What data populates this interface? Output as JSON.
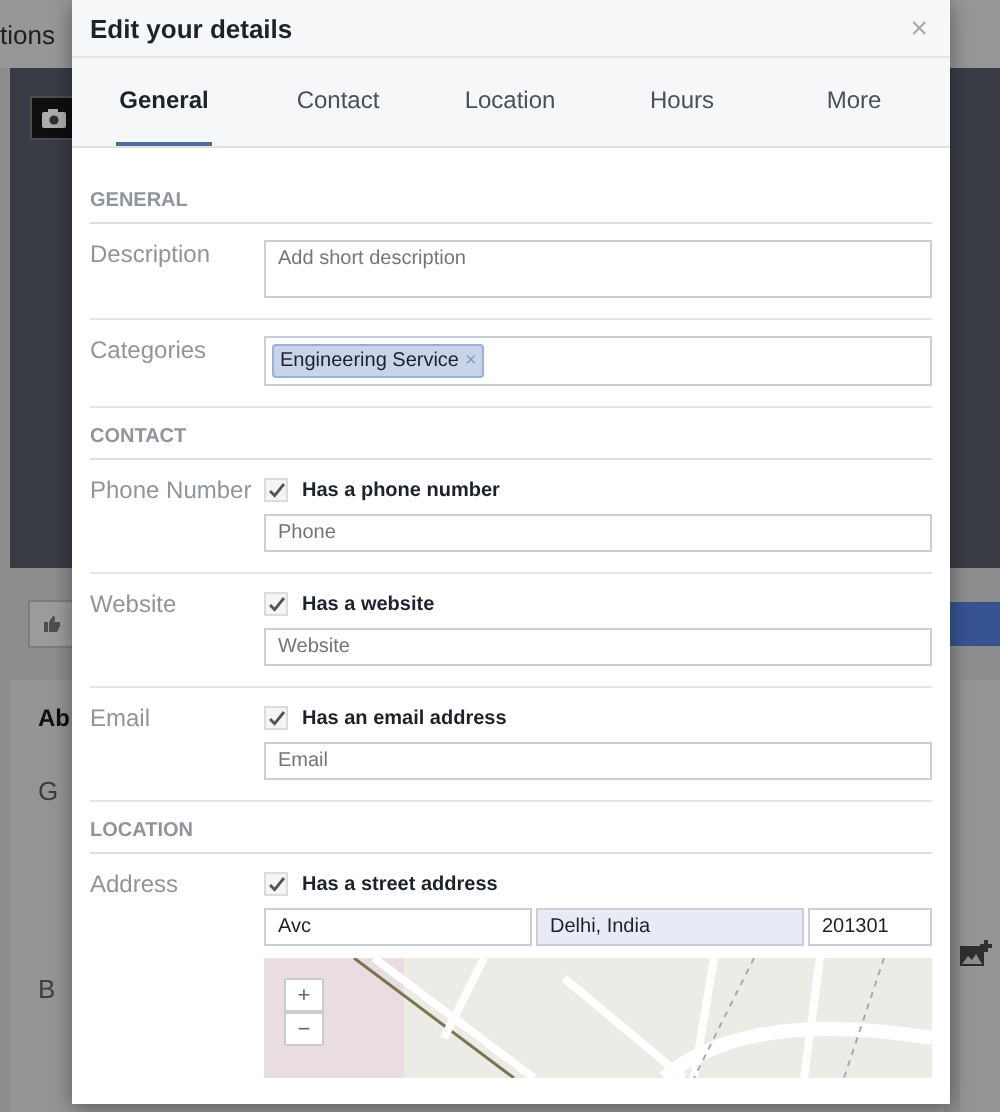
{
  "background": {
    "top_text": "tions",
    "card_texts": [
      "Ab",
      "G",
      "B"
    ]
  },
  "dialog": {
    "title": "Edit your details",
    "close": "×",
    "tabs": [
      {
        "label": "General",
        "selected": true
      },
      {
        "label": "Contact",
        "selected": false
      },
      {
        "label": "Location",
        "selected": false
      },
      {
        "label": "Hours",
        "selected": false
      },
      {
        "label": "More",
        "selected": false
      }
    ],
    "sections": [
      {
        "heading": "GENERAL",
        "rows": [
          {
            "kind": "textarea",
            "label": "Description",
            "placeholder": "Add short description"
          },
          {
            "kind": "tags",
            "label": "Categories",
            "tags": [
              {
                "text": "Engineering Service",
                "remove": "×"
              }
            ]
          }
        ]
      },
      {
        "heading": "CONTACT",
        "rows": [
          {
            "kind": "toggle_input",
            "label": "Phone Number",
            "checkbox": {
              "label": "Has a phone number",
              "checked": true
            },
            "placeholder": "Phone"
          },
          {
            "kind": "toggle_input",
            "label": "Website",
            "checkbox": {
              "label": "Has a website",
              "checked": true
            },
            "placeholder": "Website"
          },
          {
            "kind": "toggle_input",
            "label": "Email",
            "checkbox": {
              "label": "Has an email address",
              "checked": true
            },
            "placeholder": "Email"
          }
        ]
      },
      {
        "heading": "LOCATION",
        "rows": [
          {
            "kind": "address",
            "label": "Address",
            "checkbox": {
              "label": "Has a street address",
              "checked": true
            },
            "fields": [
              {
                "value": "Avc",
                "highlighted": false
              },
              {
                "value": "Delhi, India",
                "highlighted": true
              },
              {
                "value": "201301",
                "highlighted": false
              }
            ],
            "map": {
              "zoom_in": "+",
              "zoom_out": "−"
            }
          }
        ]
      }
    ]
  }
}
